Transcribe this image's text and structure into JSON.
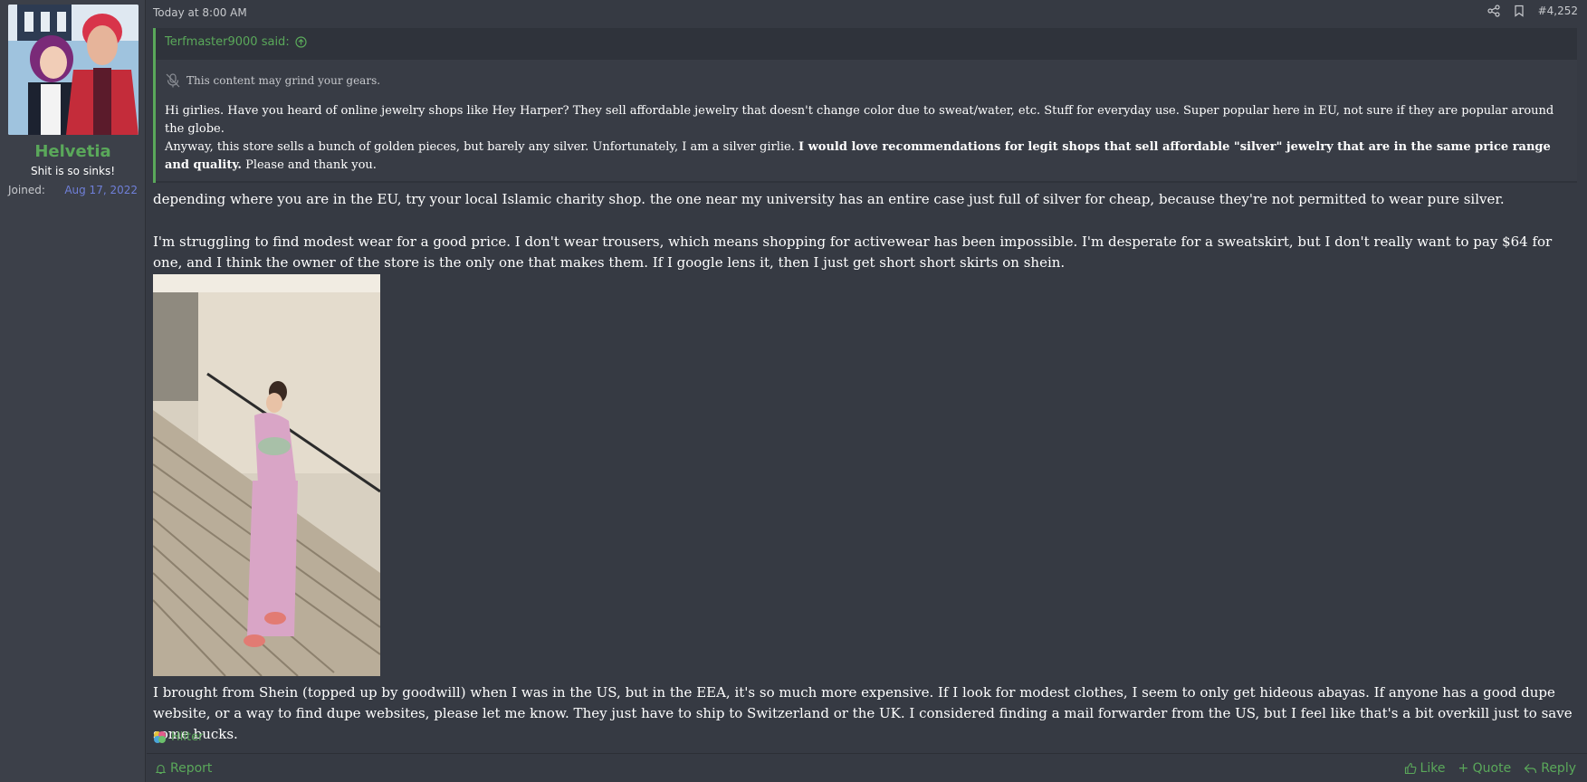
{
  "user": {
    "name": "Helvetia",
    "title": "Shit is so sinks!",
    "joined_label": "Joined:",
    "joined_date": "Aug 17, 2022"
  },
  "post": {
    "date": "Today at 8:00 AM",
    "number": "#4,252",
    "quote": {
      "author": "Terfmaster9000 said:",
      "spoiler_note": "This content may grind your gears.",
      "p1": "Hi girlies. Have you heard of online jewelry shops like Hey Harper? They sell affordable jewelry that doesn't change color due to sweat/water, etc. Stuff for everyday use. Super popular here in EU, not sure if they are popular around the globe.",
      "p2_start": "Anyway, this store sells a bunch of golden pieces, but barely any silver. Unfortunately, I am a silver girlie. ",
      "p2_bold": "I would love recommendations for legit shops that sell affordable \"silver\" jewelry that are in the same price range and quality.",
      "p2_end": " Please and thank you."
    },
    "text1": "depending where you are in the EU, try your local Islamic charity shop. the one near my university has an entire case just full of silver for cheap, because they're not permitted to wear pure silver.",
    "text2": "I'm struggling to find modest wear for a good price. I don't wear trousers, which means shopping for activewear has been impossible. I'm desperate for a sweatskirt, but I don't really want to pay $64 for one, and I think the owner of the store is the only one that makes them. If I google lens it, then I just get short short skirts on shein.",
    "text3": "I brought from Shein (topped up by goodwill) when I was in the US, but in the EEA, it's so much more expensive. If I look for modest clothes, I seem to only get hideous abayas. If anyone has a good dupe website, or a way to find dupe websites, please let me know. They just have to ship to Switzerland or the UK. I considered finding a mail forwarder from the US, but I feel like that's a bit overkill just to save some bucks.",
    "reaction_user": "Hilter"
  },
  "footer": {
    "report": "Report",
    "like": "Like",
    "quote": "+ Quote",
    "reply": "Reply"
  },
  "colors": {
    "accent_green": "#5aa85a",
    "background": "#363a43",
    "date_blue": "#6f7fd8"
  }
}
